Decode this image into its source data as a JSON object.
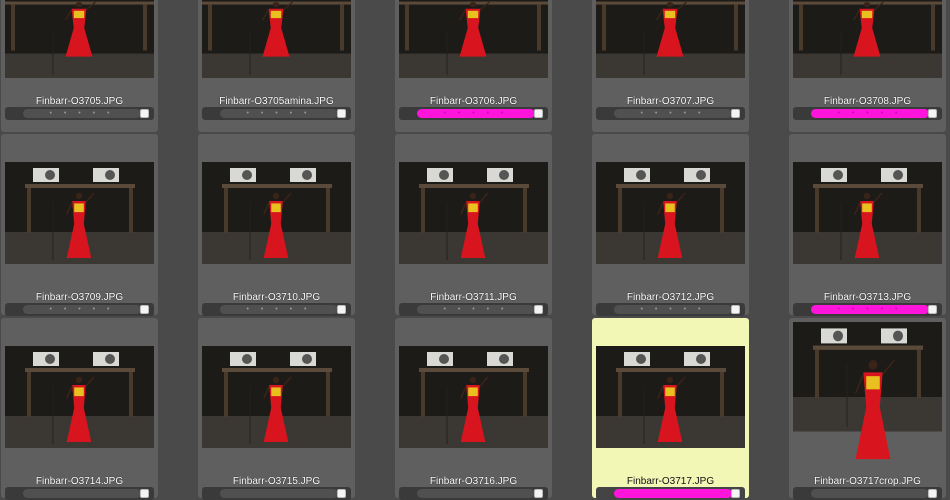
{
  "accent_colors": {
    "label_magenta": "#ff14dc",
    "selected_cell": "#f2f7b6"
  },
  "rows": [
    {
      "cells": [
        {
          "filename": "Finbarr-O3705.JPG",
          "label_color": "none",
          "stars": "• • • • •",
          "selected": false,
          "photo": "wide-front"
        },
        {
          "filename": "Finbarr-O3705amina.JPG",
          "label_color": "none",
          "stars": "• • • • •",
          "selected": false,
          "photo": "wide-front"
        },
        {
          "filename": "Finbarr-O3706.JPG",
          "label_color": "magenta",
          "stars": "• • • • •",
          "selected": false,
          "photo": "wide-front"
        },
        {
          "filename": "Finbarr-O3707.JPG",
          "label_color": "none",
          "stars": "• • • • •",
          "selected": false,
          "photo": "wide-studio"
        },
        {
          "filename": "Finbarr-O3708.JPG",
          "label_color": "magenta",
          "stars": "• • • • •",
          "selected": false,
          "photo": "wide-studio"
        }
      ]
    },
    {
      "cells": [
        {
          "filename": "Finbarr-O3709.JPG",
          "label_color": "none",
          "stars": "• • • • •",
          "selected": false,
          "photo": "studio"
        },
        {
          "filename": "Finbarr-O3710.JPG",
          "label_color": "none",
          "stars": "• • • • •",
          "selected": false,
          "photo": "studio"
        },
        {
          "filename": "Finbarr-O3711.JPG",
          "label_color": "none",
          "stars": "• • • • •",
          "selected": false,
          "photo": "studio"
        },
        {
          "filename": "Finbarr-O3712.JPG",
          "label_color": "none",
          "stars": "• • • • •",
          "selected": false,
          "photo": "studio"
        },
        {
          "filename": "Finbarr-O3713.JPG",
          "label_color": "magenta",
          "stars": "• • • • •",
          "selected": false,
          "photo": "studio"
        }
      ]
    },
    {
      "cells": [
        {
          "filename": "Finbarr-O3714.JPG",
          "label_color": "none",
          "stars": "",
          "selected": false,
          "photo": "studio"
        },
        {
          "filename": "Finbarr-O3715.JPG",
          "label_color": "none",
          "stars": "",
          "selected": false,
          "photo": "studio"
        },
        {
          "filename": "Finbarr-O3716.JPG",
          "label_color": "none",
          "stars": "",
          "selected": false,
          "photo": "studio"
        },
        {
          "filename": "Finbarr-O3717.JPG",
          "label_color": "magenta",
          "stars": "",
          "selected": true,
          "photo": "studio"
        },
        {
          "filename": "Finbarr-O3717crop.JPG",
          "label_color": "none",
          "stars": "",
          "selected": false,
          "photo": "crop"
        }
      ]
    }
  ]
}
